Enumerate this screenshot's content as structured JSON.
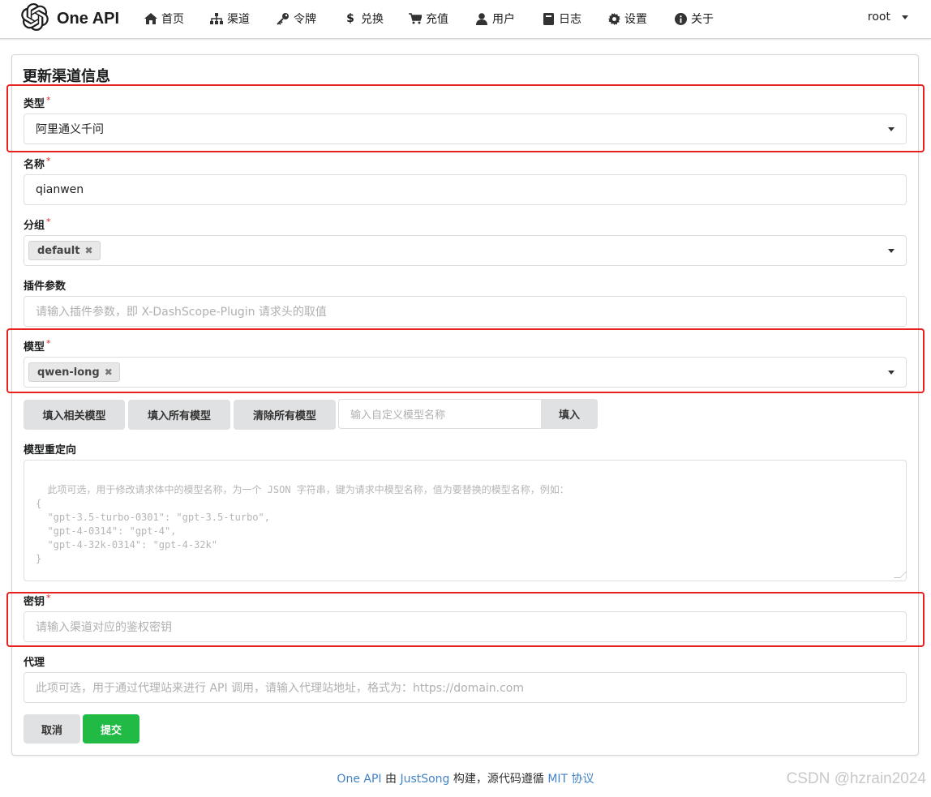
{
  "nav": {
    "brand": "One API",
    "items": [
      {
        "label": "首页",
        "icon": "home-icon"
      },
      {
        "label": "渠道",
        "icon": "sitemap-icon"
      },
      {
        "label": "令牌",
        "icon": "key-icon"
      },
      {
        "label": "兑换",
        "icon": "dollar-icon"
      },
      {
        "label": "充值",
        "icon": "cart-icon"
      },
      {
        "label": "用户",
        "icon": "user-icon"
      },
      {
        "label": "日志",
        "icon": "book-icon"
      },
      {
        "label": "设置",
        "icon": "gear-icon"
      },
      {
        "label": "关于",
        "icon": "info-icon"
      }
    ],
    "user": "root"
  },
  "form": {
    "title": "更新渠道信息",
    "type": {
      "label": "类型",
      "value": "阿里通义千问"
    },
    "name": {
      "label": "名称",
      "value": "qianwen"
    },
    "group": {
      "label": "分组",
      "tags": [
        "default"
      ]
    },
    "plugin": {
      "label": "插件参数",
      "placeholder": "请输入插件参数，即 X-DashScope-Plugin 请求头的取值"
    },
    "models": {
      "label": "模型",
      "tags": [
        "qwen-long"
      ]
    },
    "model_buttons": {
      "fill_related": "填入相关模型",
      "fill_all": "填入所有模型",
      "clear_all": "清除所有模型",
      "custom_placeholder": "输入自定义模型名称",
      "fill": "填入"
    },
    "mapping": {
      "label": "模型重定向",
      "placeholder": "此项可选，用于修改请求体中的模型名称，为一个 JSON 字符串，键为请求中模型名称，值为要替换的模型名称，例如：\n{\n  \"gpt-3.5-turbo-0301\": \"gpt-3.5-turbo\",\n  \"gpt-4-0314\": \"gpt-4\",\n  \"gpt-4-32k-0314\": \"gpt-4-32k\"\n}"
    },
    "key": {
      "label": "密钥",
      "placeholder": "请输入渠道对应的鉴权密钥"
    },
    "proxy": {
      "label": "代理",
      "placeholder": "此项可选，用于通过代理站来进行 API 调用，请输入代理站地址，格式为：https://domain.com"
    },
    "cancel": "取消",
    "submit": "提交"
  },
  "footer": {
    "link1": "One API",
    "text1": " 由 ",
    "link2": "JustSong",
    "text2": " 构建，源代码遵循 ",
    "link3": "MIT 协议"
  },
  "watermark": "CSDN @hzrain2024",
  "colors": {
    "accent": "#21ba45",
    "highlight": "#e8211e",
    "link": "#4183c4",
    "required": "#db2828"
  }
}
